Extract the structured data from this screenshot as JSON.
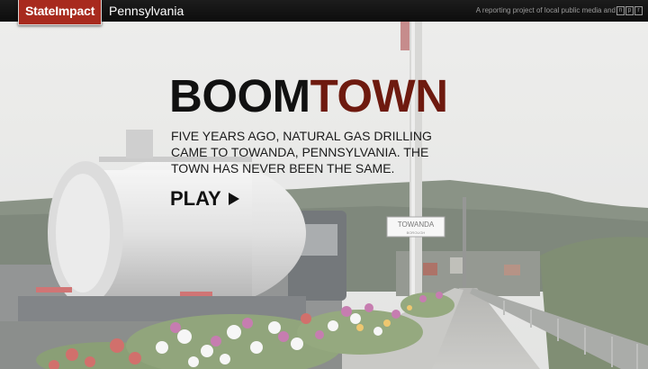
{
  "header": {
    "logo_text": "StateImpact",
    "region": "Pennsylvania",
    "tagline": "A reporting project of local public media and",
    "npr_letters": [
      "n",
      "p",
      "r"
    ]
  },
  "hero": {
    "title_part1": "BOOM",
    "title_part2": "TOWN",
    "dek": "Five years ago, natural gas drilling came to Towanda, Pennsylvania. The town has never been the same.",
    "play_label": "PLAY",
    "sign_text": "TOWANDA",
    "sign_subtext": "BOROUGH"
  },
  "colors": {
    "brand_red": "#a82a1e",
    "title_dark": "#111111",
    "title_red": "#6e1a0f"
  },
  "icons": {
    "play": "play-triangle-icon"
  }
}
